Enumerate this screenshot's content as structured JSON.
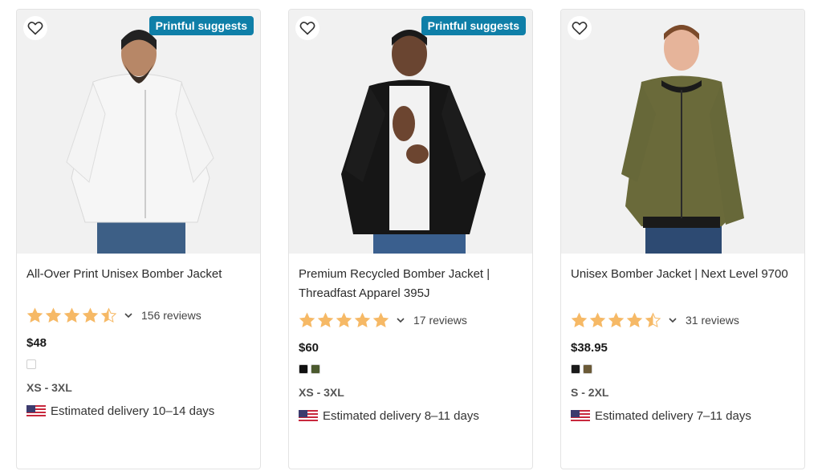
{
  "products": [
    {
      "badge": "Printful suggests",
      "title": "All-Over Print Unisex Bomber Jacket",
      "rating": 4.5,
      "reviews": "156 reviews",
      "price": "$48",
      "colors": [
        "#ffffff"
      ],
      "sizes": "XS - 3XL",
      "delivery": "Estimated delivery 10–14 days",
      "jacket_color": "#f6f6f6",
      "pants_color": "#3d5f86"
    },
    {
      "badge": "Printful suggests",
      "title": "Premium Recycled Bomber Jacket | Threadfast Apparel 395J",
      "rating": 5,
      "reviews": "17 reviews",
      "price": "$60",
      "colors": [
        "#111111",
        "#4b5a2e"
      ],
      "sizes": "XS - 3XL",
      "delivery": "Estimated delivery 8–11 days",
      "jacket_color": "#161616",
      "pants_color": "#3a5f8e"
    },
    {
      "badge": "",
      "title": "Unisex Bomber Jacket | Next Level 9700",
      "rating": 4.5,
      "reviews": "31 reviews",
      "price": "$38.95",
      "colors": [
        "#1a1a1a",
        "#6b5a37"
      ],
      "sizes": "S - 2XL",
      "delivery": "Estimated delivery 7–11 days",
      "jacket_color": "#6a6a3a",
      "pants_color": "#2d4a72"
    }
  ],
  "star_color": "#f6b966",
  "star_empty_color": "#d9d9d9",
  "heart_icon": "heart-outline-icon",
  "flag_icon": "us-flag-icon"
}
